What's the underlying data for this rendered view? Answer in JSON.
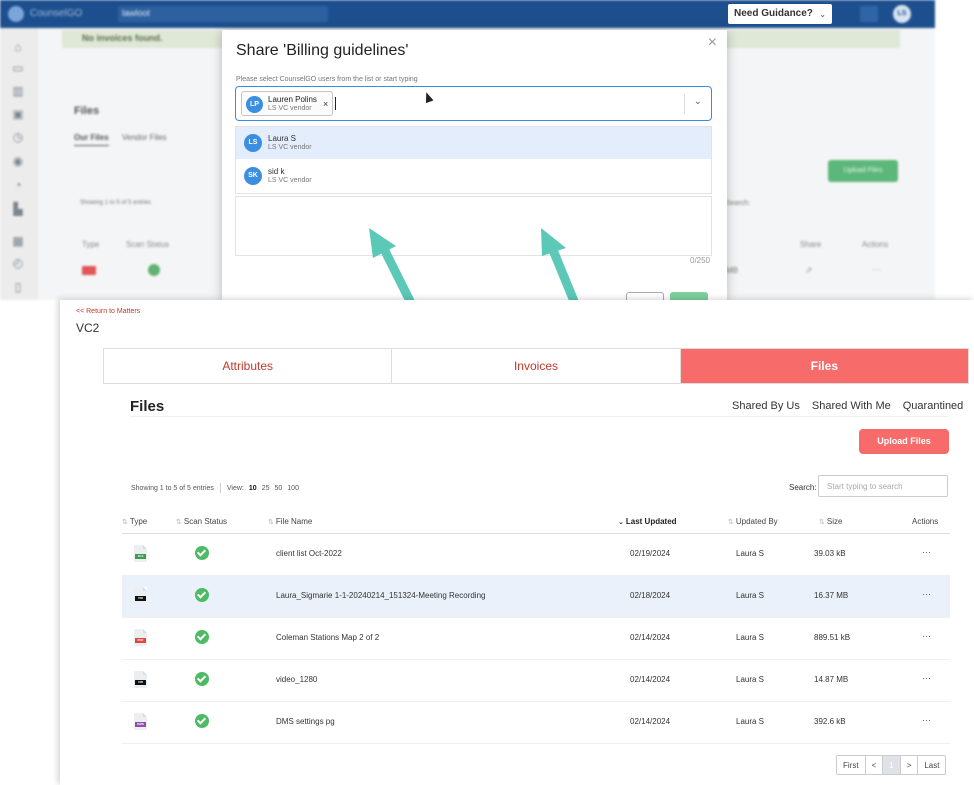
{
  "background_app": {
    "brand": "CounselGO",
    "selector": "lawloot",
    "alert": "No invoices found.",
    "guidance": "Need Guidance?",
    "avatar": "LS",
    "files_title": "Files",
    "tabs": [
      "Our Files",
      "Vendor Files"
    ],
    "upload_label": "Upload Files",
    "showing": "Showing 1 to 5 of 5 entries",
    "search_label": "Search:",
    "headers": [
      "Type",
      "Scan Status",
      "Share",
      "Actions"
    ],
    "row_size": "MB"
  },
  "modal": {
    "title": "Share 'Billing guidelines'",
    "close": "×",
    "instruction": "Please select CounselGO users from the list or start typing",
    "selected_user": {
      "initials": "LP",
      "name": "Lauren Polins",
      "org": "LS VC vendor",
      "remove": "×"
    },
    "options": [
      {
        "initials": "LS",
        "name": "Laura S",
        "org": "LS VC vendor"
      },
      {
        "initials": "SK",
        "name": "sid k",
        "org": "LS VC vendor"
      }
    ],
    "counter": "0/250"
  },
  "front": {
    "return_link": "<< Return to Matters",
    "matter": "VC2",
    "tabs": [
      {
        "label": "Attributes"
      },
      {
        "label": "Invoices"
      },
      {
        "label": "Files"
      }
    ],
    "files_title": "Files",
    "sub_tabs": [
      "Shared By Us",
      "Shared With Me",
      "Quarantined"
    ],
    "upload_label": "Upload Files",
    "showing": "Showing 1 to 5 of 5 entries",
    "view_label": "View:",
    "view_options": [
      "10",
      "25",
      "50",
      "100"
    ],
    "search_label": "Search:",
    "search_placeholder": "Start typing to search",
    "columns": [
      "Type",
      "Scan Status",
      "File Name",
      "Last Updated",
      "Updated By",
      "Size",
      "Actions"
    ],
    "rows": [
      {
        "type": "XLS",
        "type_color": "#3d9a4f",
        "name": "client list Oct-2022",
        "updated": "02/19/2024",
        "by": "Laura S",
        "size": "39.03 kB",
        "actions": "···"
      },
      {
        "type": "VID",
        "type_color": "#111111",
        "name": "Laura_Sigmarie 1-1-20240214_151324-Meeting Recording",
        "updated": "02/18/2024",
        "by": "Laura S",
        "size": "16.37 MB",
        "actions": "···"
      },
      {
        "type": "PDF",
        "type_color": "#e0463f",
        "name": "Coleman Stations Map 2 of 2",
        "updated": "02/14/2024",
        "by": "Laura S",
        "size": "889.51 kB",
        "actions": "···"
      },
      {
        "type": "VID",
        "type_color": "#111111",
        "name": "video_1280",
        "updated": "02/14/2024",
        "by": "Laura S",
        "size": "14.87 MB",
        "actions": "···"
      },
      {
        "type": "DMS",
        "type_color": "#8e4fb0",
        "name": "DMS settings pg",
        "updated": "02/14/2024",
        "by": "Laura S",
        "size": "392.6 kB",
        "actions": "···"
      }
    ],
    "pagination": [
      "First",
      "<",
      "1",
      ">",
      "Last"
    ]
  },
  "colors": {
    "accent": "#f76b6b",
    "link": "#c0392b",
    "arrow": "#5cc8b8",
    "select_border": "#3a8be0",
    "scan_ok": "#4cbb64"
  }
}
